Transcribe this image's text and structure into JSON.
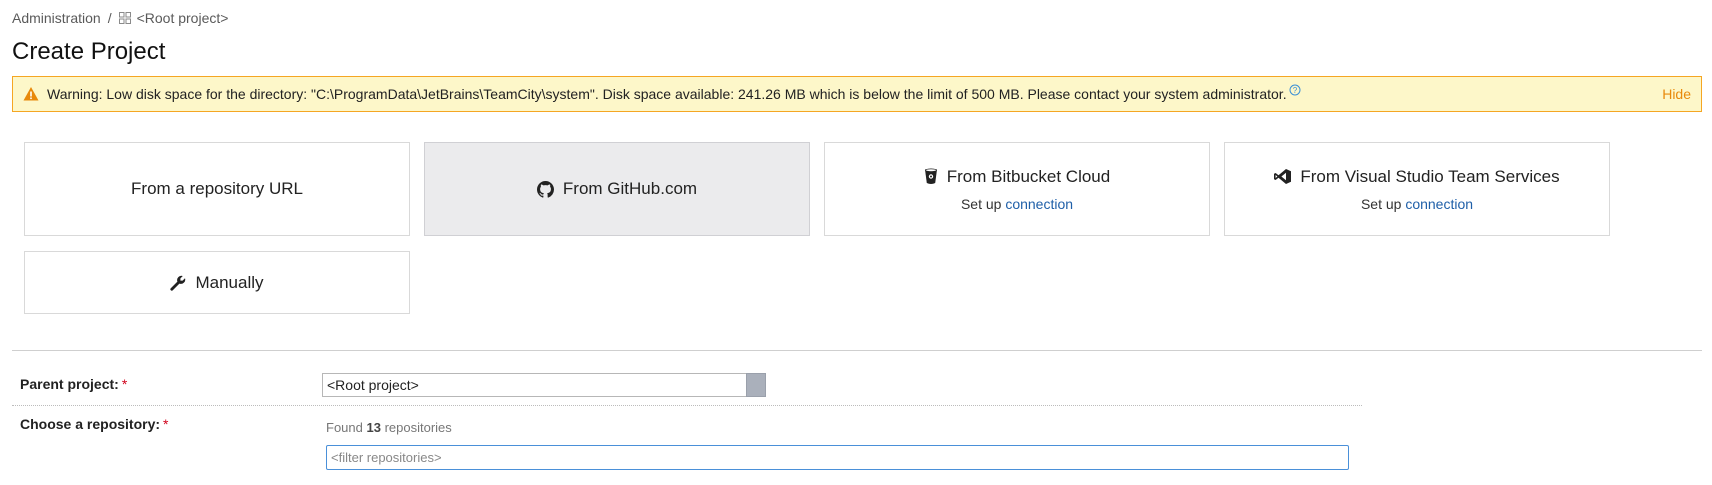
{
  "breadcrumb": {
    "root": "Administration",
    "separator": "/",
    "project": "<Root project>"
  },
  "page": {
    "title": "Create Project"
  },
  "warning": {
    "message": "Warning: Low disk space for the directory: \"C:\\ProgramData\\JetBrains\\TeamCity\\system\". Disk space available: 241.26 MB which is below the limit of 500 MB. Please contact your system administrator.",
    "hide_label": "Hide"
  },
  "options": {
    "repo_url": {
      "label": "From a repository URL"
    },
    "github": {
      "label": "From GitHub.com",
      "selected": true
    },
    "bitbucket": {
      "label": "From Bitbucket Cloud",
      "sub_prefix": "Set up",
      "sub_link": "connection"
    },
    "vsts": {
      "label": "From Visual Studio Team Services",
      "sub_prefix": "Set up",
      "sub_link": "connection"
    },
    "manual": {
      "label": "Manually"
    }
  },
  "form": {
    "parent_label": "Parent project:",
    "parent_value": "<Root project>",
    "repo_label": "Choose a repository:",
    "required_mark": "*",
    "found_prefix": "Found",
    "found_count": "13",
    "found_suffix": "repositories",
    "filter_placeholder": "<filter repositories>"
  },
  "colors": {
    "warning_bg": "#fdf7c9",
    "warning_border": "#f5a623",
    "link": "#1f5fa8",
    "required": "#d0021b",
    "selected_tile": "#ebebed"
  }
}
